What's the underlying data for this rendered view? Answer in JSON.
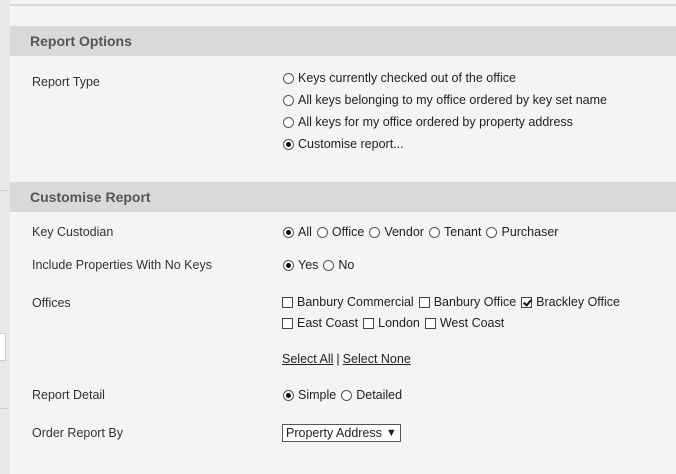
{
  "report_options": {
    "title": "Report Options",
    "report_type_label": "Report Type",
    "report_types": [
      {
        "label": "Keys currently checked out of the office",
        "selected": false
      },
      {
        "label": "All keys belonging to my office ordered by key set name",
        "selected": false
      },
      {
        "label": "All keys for my office ordered by property address",
        "selected": false
      },
      {
        "label": "Customise report...",
        "selected": true
      }
    ]
  },
  "customise_report": {
    "title": "Customise Report",
    "key_custodian": {
      "label": "Key Custodian",
      "options": [
        {
          "label": "All",
          "selected": true
        },
        {
          "label": "Office",
          "selected": false
        },
        {
          "label": "Vendor",
          "selected": false
        },
        {
          "label": "Tenant",
          "selected": false
        },
        {
          "label": "Purchaser",
          "selected": false
        }
      ]
    },
    "include_no_keys": {
      "label": "Include Properties With No Keys",
      "options": [
        {
          "label": "Yes",
          "selected": true
        },
        {
          "label": "No",
          "selected": false
        }
      ]
    },
    "offices": {
      "label": "Offices",
      "row1": [
        {
          "label": "Banbury Commercial",
          "checked": false
        },
        {
          "label": "Banbury Office",
          "checked": false
        },
        {
          "label": "Brackley Office",
          "checked": true
        }
      ],
      "row2": [
        {
          "label": "East Coast",
          "checked": false
        },
        {
          "label": "London",
          "checked": false
        },
        {
          "label": "West Coast",
          "checked": false
        }
      ],
      "select_all": "Select All",
      "separator": "|",
      "select_none": "Select None"
    },
    "report_detail": {
      "label": "Report Detail",
      "options": [
        {
          "label": "Simple",
          "selected": true
        },
        {
          "label": "Detailed",
          "selected": false
        }
      ]
    },
    "order_by": {
      "label": "Order Report By",
      "selected": "Property Address"
    }
  }
}
